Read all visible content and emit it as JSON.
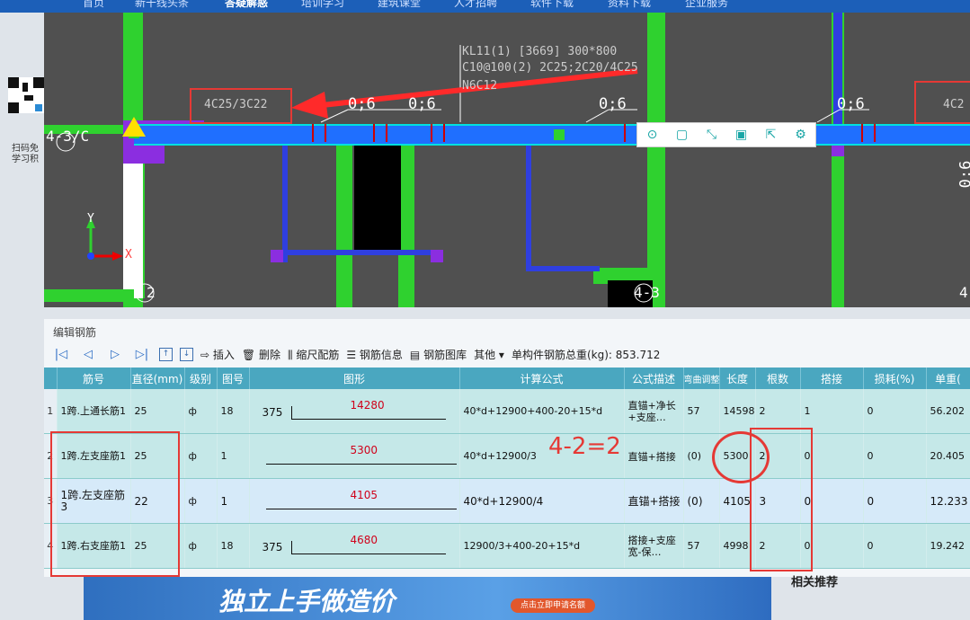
{
  "site_nav": [
    "首页",
    "新干线头条",
    "答疑解惑",
    "培训学习",
    "建筑课堂",
    "人才招聘",
    "软件下载",
    "资料下载",
    "企业服务"
  ],
  "sidebar": {
    "qr_text": "扫码免\n学习积"
  },
  "cad": {
    "beam_label_line1": "KL11(1) [3669] 300*800",
    "beam_label_line2": "C10@100(2) 2C25;2C20/4C25",
    "beam_label_line3": "N6C12",
    "left_support_label": "4C25/3C22",
    "right_support_label": "4C2",
    "dim_labels": [
      "0;6",
      "0;6",
      "0;6",
      "0;6"
    ],
    "vertical_dim": "0;6",
    "axis_43C": "4-3/C",
    "axis_2": "2",
    "axis_43": "4-3",
    "axis_4": "4",
    "coord_y": "Y",
    "coord_x": "X"
  },
  "float_toolbar": [
    "search-icon",
    "copy-icon",
    "expand-icon",
    "save-icon",
    "export-icon",
    "settings-icon"
  ],
  "panel": {
    "title": "编辑钢筋",
    "toolbar": {
      "insert": "插入",
      "delete": "删除",
      "scale": "缩尺配筋",
      "info": "钢筋信息",
      "library": "钢筋图库",
      "other": "其他",
      "total_label": "单构件钢筋总重(kg): 853.712"
    },
    "columns": [
      "筋号",
      "直径(mm)",
      "级别",
      "图号",
      "图形",
      "计算公式",
      "公式描述",
      "弯曲调整",
      "长度",
      "根数",
      "搭接",
      "损耗(%)",
      "单重("
    ],
    "rows": [
      {
        "idx": "1",
        "name": "1跨.上通长筋1",
        "dia": "25",
        "grade": "ф",
        "fig": "18",
        "left": "375",
        "shape_val": "14280",
        "formula": "40*d+12900+400-20+15*d",
        "desc": "直锚+净长+支座…",
        "bend": "57",
        "len": "14598",
        "count": "2",
        "lap": "1",
        "loss": "0",
        "unit": "56.202"
      },
      {
        "idx": "2",
        "name": "1跨.左支座筋1",
        "dia": "25",
        "grade": "ф",
        "fig": "1",
        "left": "",
        "shape_val": "5300",
        "formula": "40*d+12900/3",
        "desc": "直锚+搭接",
        "bend": "(0)",
        "len": "5300",
        "count": "2",
        "lap": "0",
        "loss": "0",
        "unit": "20.405"
      },
      {
        "idx": "3",
        "name": "1跨.左支座筋3",
        "dia": "22",
        "grade": "ф",
        "fig": "1",
        "left": "",
        "shape_val": "4105",
        "formula": "40*d+12900/4",
        "desc": "直锚+搭接",
        "bend": "(0)",
        "len": "4105",
        "count": "3",
        "lap": "0",
        "loss": "0",
        "unit": "12.233"
      },
      {
        "idx": "4",
        "name": "1跨.右支座筋1",
        "dia": "25",
        "grade": "ф",
        "fig": "18",
        "left": "375",
        "shape_val": "4680",
        "formula": "12900/3+400-20+15*d",
        "desc": "搭接+支座宽-保…",
        "bend": "57",
        "len": "4998",
        "count": "2",
        "lap": "0",
        "loss": "0",
        "unit": "19.242"
      }
    ]
  },
  "annotation": "4-2=2",
  "banner": {
    "title": "独立上手做造价",
    "button": "点击立即申请名额"
  },
  "related": "相关推荐"
}
